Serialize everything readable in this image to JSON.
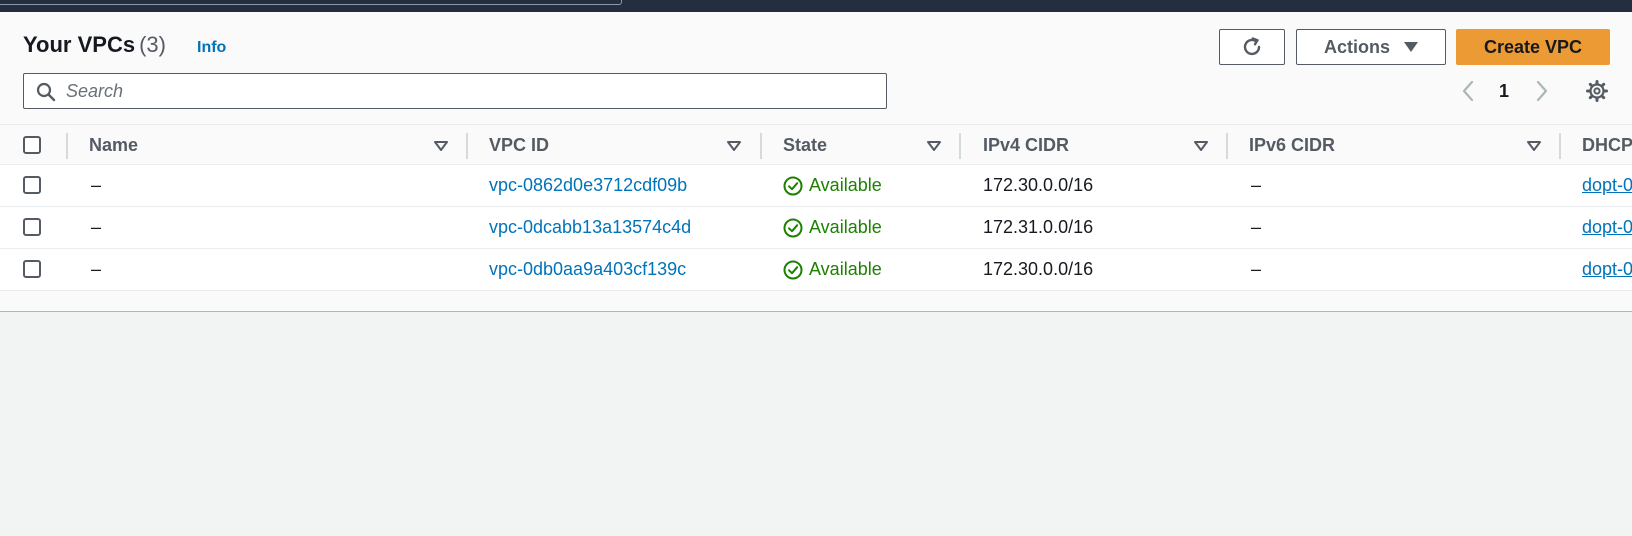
{
  "header": {
    "title": "Your VPCs",
    "count": "(3)",
    "info_label": "Info"
  },
  "toolbar": {
    "refresh_icon": "refresh-icon",
    "actions_label": "Actions",
    "create_label": "Create VPC"
  },
  "search": {
    "placeholder": "Search",
    "value": ""
  },
  "pagination": {
    "current_page": "1"
  },
  "table": {
    "columns": [
      "Name",
      "VPC ID",
      "State",
      "IPv4 CIDR",
      "IPv6 CIDR",
      "DHCP"
    ],
    "rows": [
      {
        "name": "–",
        "vpc_id": "vpc-0862d0e3712cdf09b",
        "state": "Available",
        "ipv4": "172.30.0.0/16",
        "ipv6": "–",
        "dhcp": "dopt-0"
      },
      {
        "name": "–",
        "vpc_id": "vpc-0dcabb13a13574c4d",
        "state": "Available",
        "ipv4": "172.31.0.0/16",
        "ipv6": "–",
        "dhcp": "dopt-0"
      },
      {
        "name": "–",
        "vpc_id": "vpc-0db0aa9a403cf139c",
        "state": "Available",
        "ipv4": "172.30.0.0/16",
        "ipv6": "–",
        "dhcp": "dopt-0"
      }
    ]
  },
  "colors": {
    "primary_button": "#ec9a34",
    "link": "#0073bb",
    "success": "#1d8102",
    "top_nav": "#232f3e"
  }
}
